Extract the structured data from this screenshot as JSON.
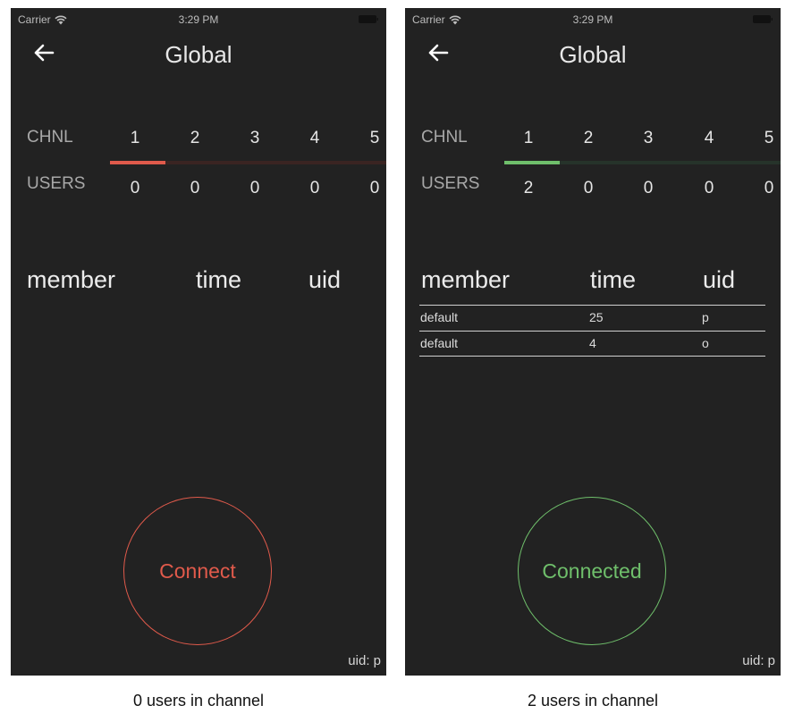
{
  "status_bar": {
    "carrier": "Carrier",
    "time": "3:29 PM"
  },
  "colors": {
    "background": "#222222",
    "disconnected_accent": "#e05a4b",
    "disconnected_track": "#3a2422",
    "connected_accent": "#6fbf6b",
    "connected_track": "#26332a"
  },
  "screens": [
    {
      "title": "Global",
      "chnl_label": "CHNL",
      "users_label": "USERS",
      "channels": [
        "1",
        "2",
        "3",
        "4",
        "5"
      ],
      "user_counts": [
        "0",
        "0",
        "0",
        "0",
        "0"
      ],
      "selected_channel": 1,
      "table_headers": {
        "member": "member",
        "time": "time",
        "uid": "uid"
      },
      "rows": [],
      "button_label": "Connect",
      "uid_footer": "uid: p",
      "caption": "0 users in channel"
    },
    {
      "title": "Global",
      "chnl_label": "CHNL",
      "users_label": "USERS",
      "channels": [
        "1",
        "2",
        "3",
        "4",
        "5"
      ],
      "user_counts": [
        "2",
        "0",
        "0",
        "0",
        "0"
      ],
      "selected_channel": 1,
      "table_headers": {
        "member": "member",
        "time": "time",
        "uid": "uid"
      },
      "rows": [
        {
          "member": "default",
          "time": "25",
          "uid": "p"
        },
        {
          "member": "default",
          "time": "4",
          "uid": "o"
        }
      ],
      "button_label": "Connected",
      "uid_footer": "uid: p",
      "caption": "2 users in channel"
    }
  ]
}
